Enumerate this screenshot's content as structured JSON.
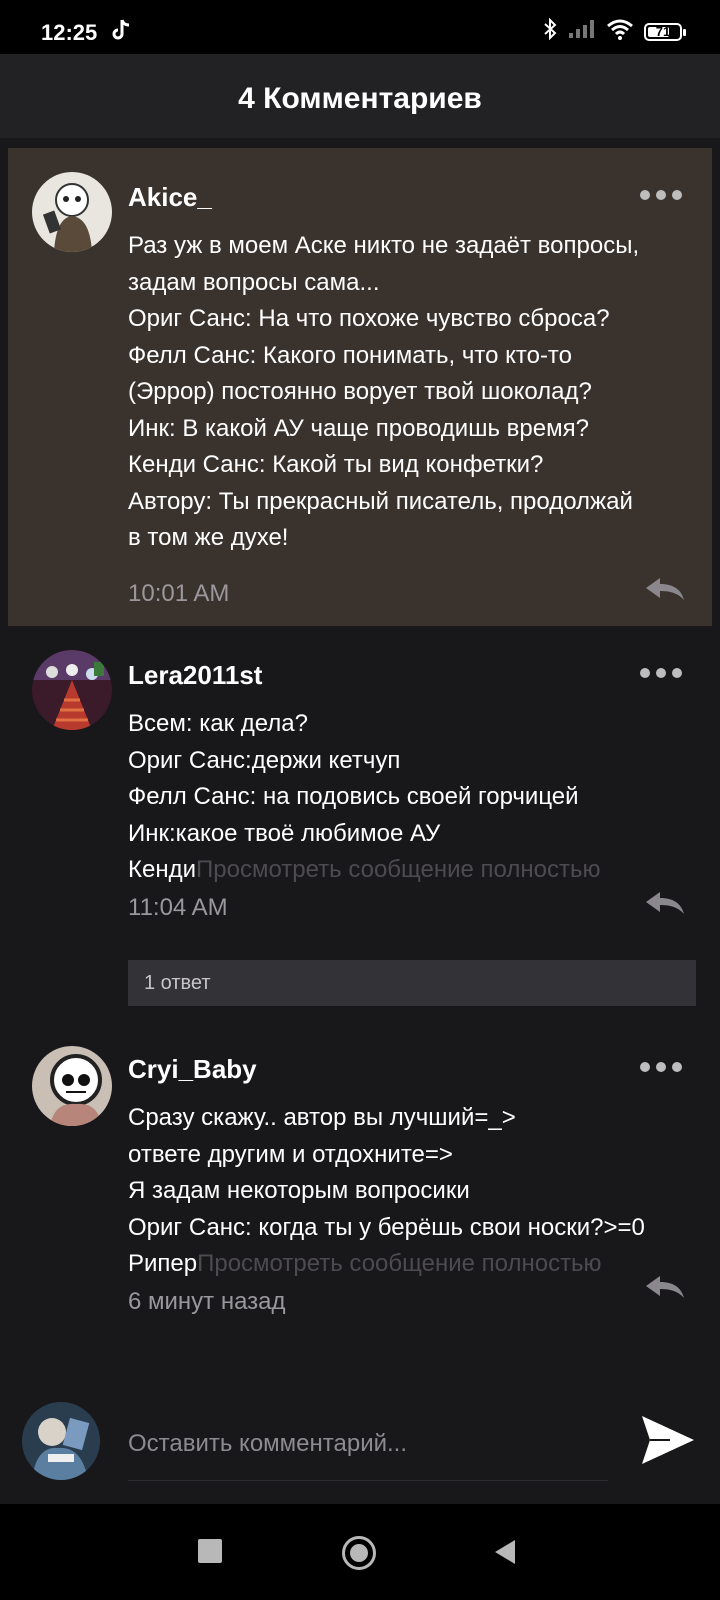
{
  "status_bar": {
    "time": "12:25",
    "battery": "71",
    "battery_level": 0.71,
    "icons": [
      "tiktok-icon",
      "bluetooth-icon",
      "signal-icon",
      "wifi-icon",
      "battery-icon"
    ]
  },
  "header": {
    "title": "4 Комментариев"
  },
  "comments": [
    {
      "username": "Akice_",
      "lines": [
        "Раз уж в моем Аске никто не задаёт вопросы,",
        "задам вопросы сама...",
        "Ориг Санс: На что похоже чувство сброса?",
        "Фелл Санс: Какого понимать, что кто-то",
        "(Эррор) постоянно ворует твой шоколад?",
        "Инк: В какой АУ чаще проводишь время?",
        "Кенди Санс: Какой ты вид конфетки?",
        "Автору: Ты прекрасный писатель, продолжай",
        "в том же духе!"
      ],
      "time": "10:01 AM"
    },
    {
      "username": "Lera2011st",
      "lines": [
        "Всем: как дела?",
        "Ориг Санс:держи кетчуп",
        "Фелл Санс: на подовись своей горчицей",
        "Инк:какое твоё любимое АУ"
      ],
      "truncated_start": "Кенди",
      "view_more": "Просмотреть сообщение полностью",
      "time": "11:04 AM",
      "replies": "1 ответ"
    },
    {
      "username": "Cryi_Baby",
      "lines": [
        "Сразу скажу.. автор вы лучший=_>",
        "ответе другим и отдохните=>",
        "Я задам некоторым вопросики",
        "Ориг Санс: когда ты у берёшь свои носки?>=0"
      ],
      "truncated_start": "Рипер",
      "view_more": "Просмотреть сообщение полностью",
      "time": "6 минут назад"
    }
  ],
  "input": {
    "placeholder": "Оставить комментарий..."
  },
  "colors": {
    "background": "#18171a",
    "highlight": "#3a322d",
    "header": "#222124",
    "muted_text": "#9a989c",
    "view_more": "#4d4b50"
  }
}
